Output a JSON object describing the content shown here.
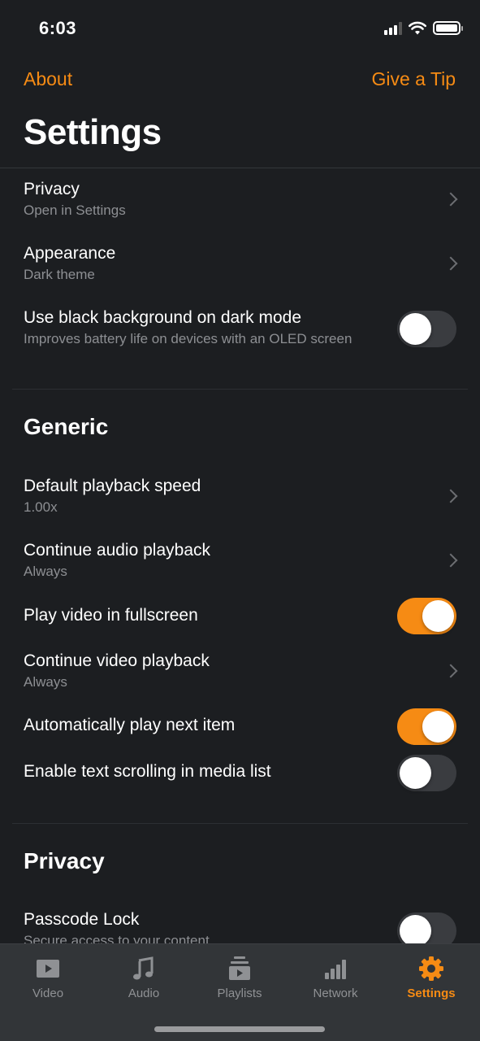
{
  "status_bar": {
    "time": "6:03",
    "signal_icon": "cellular-signal-icon",
    "wifi_icon": "wifi-icon",
    "battery_icon": "battery-full-icon"
  },
  "nav": {
    "left_label": "About",
    "right_label": "Give a Tip"
  },
  "page_title": "Settings",
  "colors": {
    "accent": "#f68b14",
    "background": "#1c1e21",
    "tab_bar": "#323538",
    "subtitle": "#8d8f93",
    "toggle_off": "#3a3c40"
  },
  "top_rows": [
    {
      "title": "Privacy",
      "subtitle": "Open in Settings",
      "control": "chevron"
    },
    {
      "title": "Appearance",
      "subtitle": "Dark theme",
      "control": "chevron"
    },
    {
      "title": "Use black background on dark mode",
      "subtitle": "Improves battery life on devices with an OLED screen",
      "control": "toggle",
      "on": false
    }
  ],
  "sections": [
    {
      "title": "Generic",
      "rows": [
        {
          "title": "Default playback speed",
          "subtitle": "1.00x",
          "control": "chevron"
        },
        {
          "title": "Continue audio playback",
          "subtitle": "Always",
          "control": "chevron"
        },
        {
          "title": "Play video in fullscreen",
          "control": "toggle",
          "on": true
        },
        {
          "title": "Continue video playback",
          "subtitle": "Always",
          "control": "chevron"
        },
        {
          "title": "Automatically play next item",
          "control": "toggle",
          "on": true
        },
        {
          "title": "Enable text scrolling in media list",
          "control": "toggle",
          "on": false
        }
      ]
    },
    {
      "title": "Privacy",
      "rows": [
        {
          "title": "Passcode Lock",
          "subtitle": "Secure access to your content",
          "control": "toggle",
          "on": false
        }
      ]
    }
  ],
  "tab_bar": {
    "tabs": [
      {
        "label": "Video",
        "icon": "video-icon",
        "active": false
      },
      {
        "label": "Audio",
        "icon": "music-note-icon",
        "active": false
      },
      {
        "label": "Playlists",
        "icon": "playlist-icon",
        "active": false
      },
      {
        "label": "Network",
        "icon": "network-bars-icon",
        "active": false
      },
      {
        "label": "Settings",
        "icon": "gear-icon",
        "active": true
      }
    ]
  }
}
